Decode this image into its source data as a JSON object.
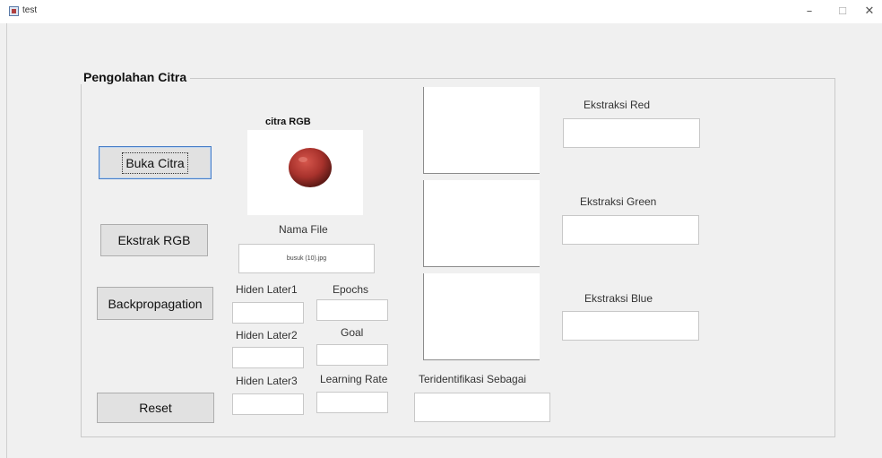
{
  "window": {
    "title": "test",
    "minimize_glyph": "–",
    "maximize_glyph": "☐",
    "close_glyph": "✕"
  },
  "panel": {
    "title": "Pengolahan Citra"
  },
  "buttons": {
    "buka_citra": "Buka Citra",
    "ekstrak_rgb": "Ekstrak RGB",
    "backpropagation": "Backpropagation",
    "reset": "Reset"
  },
  "image_section": {
    "title": "citra RGB",
    "image_icon": "red-fruit-image",
    "image_color": "#a8322c",
    "nama_file_label": "Nama File",
    "nama_file_value": "busuk (10).jpg"
  },
  "parameters": {
    "hiden_layer1_label": "Hiden Later1",
    "hiden_layer1_value": "",
    "epochs_label": "Epochs",
    "epochs_value": "",
    "hiden_layer2_label": "Hiden Later2",
    "hiden_layer2_value": "",
    "goal_label": "Goal",
    "goal_value": "",
    "hiden_layer3_label": "Hiden Later3",
    "hiden_layer3_value": "",
    "learning_rate_label": "Learning Rate",
    "learning_rate_value": ""
  },
  "result": {
    "label": "Teridentifikasi Sebagai",
    "value": ""
  },
  "extraction": {
    "red_label": "Ekstraksi Red",
    "red_value": "",
    "green_label": "Ekstraksi Green",
    "green_value": "",
    "blue_label": "Ekstraksi Blue",
    "blue_value": ""
  }
}
